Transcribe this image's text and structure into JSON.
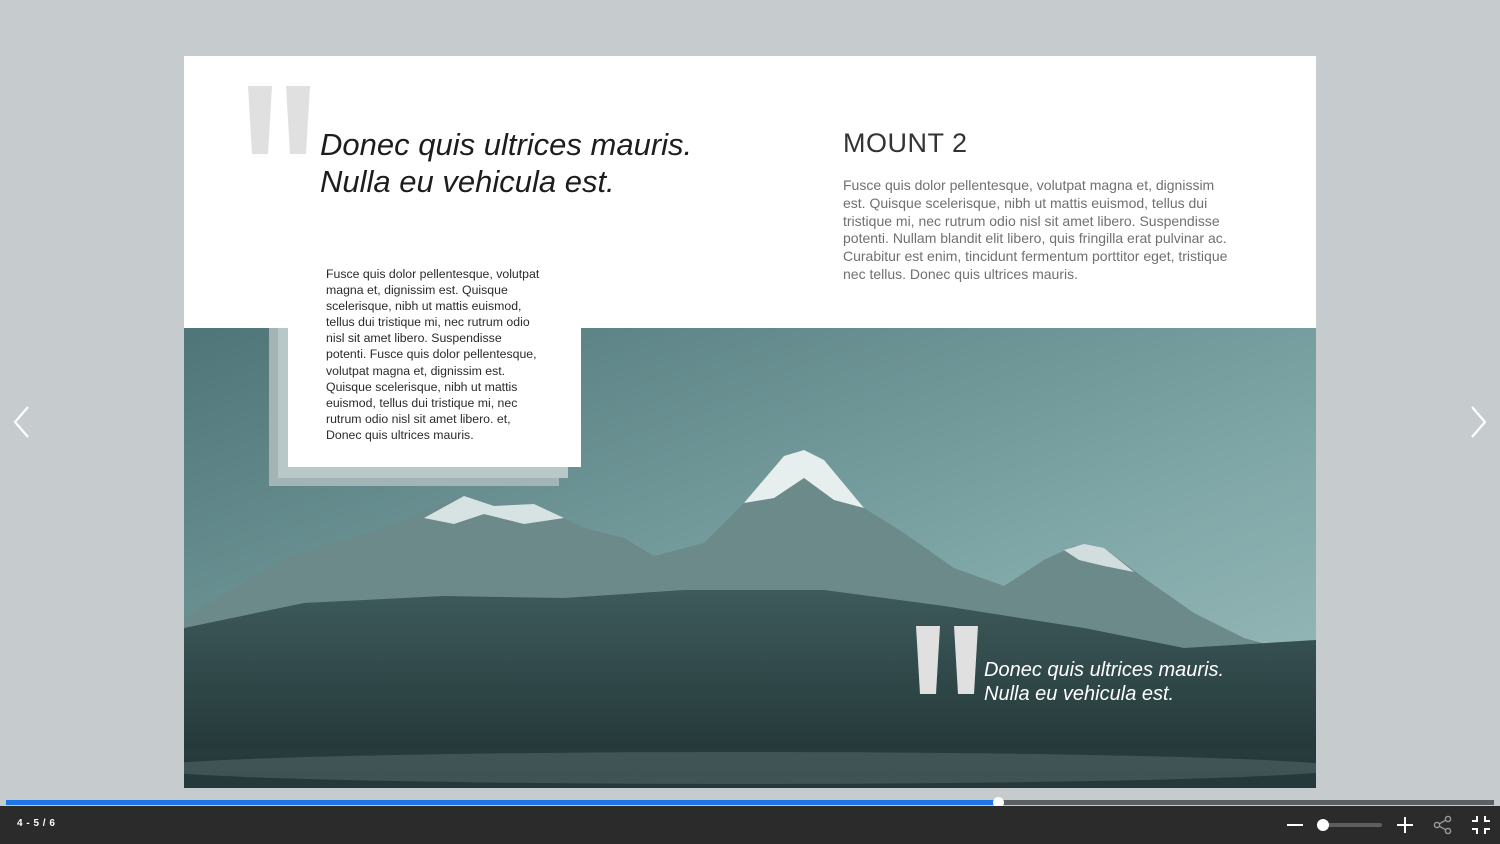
{
  "spread": {
    "quote_top": {
      "line1": "Donec quis ultrices mauris.",
      "line2": "Nulla eu vehicula est."
    },
    "title": "MOUNT 2",
    "paragraph_right": "Fusce quis dolor pellentesque, volutpat magna et, dignissim est. Quisque scelerisque, nibh ut mattis euismod, tellus dui tristique mi, nec rutrum odio nisl sit amet libero. Suspendisse potenti. Nullam blandit elit libero, quis fringilla erat pulvinar ac. Curabitur est enim, tincidunt fermentum porttitor eget, tristique nec tellus. Donec quis ultrices mauris.",
    "card_text": "Fusce quis dolor pellentesque, volutpat magna et, dignissim est. Quisque scelerisque, nibh ut mattis euismod, tellus dui tristique mi, nec rutrum odio nisl sit amet libero. Suspendisse potenti. Fusce quis dolor pellentesque, volutpat magna et, dignissim est. Quisque scelerisque, nibh ut mattis euismod, tellus dui tristique mi, nec rutrum odio nisl sit amet libero. et, Donec quis ultrices mauris.",
    "quote_bottom": {
      "line1": "Donec quis ultrices mauris.",
      "line2": "Nulla eu vehicula est."
    }
  },
  "navigation": {
    "prev_icon": "chevron-left-icon",
    "next_icon": "chevron-right-icon"
  },
  "progress": {
    "fraction": 0.667,
    "fill_color": "#1e74e8"
  },
  "toolbar": {
    "page_indicator": "4 - 5 / 6",
    "zoom_out_icon": "minus-icon",
    "zoom_in_icon": "plus-icon",
    "share_icon": "share-icon",
    "exit_fullscreen_icon": "exit-fullscreen-icon",
    "zoom_level_fraction": 0.08
  },
  "colors": {
    "background": "#c6cbcd",
    "toolbar": "#2b2b2b",
    "accent": "#1e74e8"
  }
}
